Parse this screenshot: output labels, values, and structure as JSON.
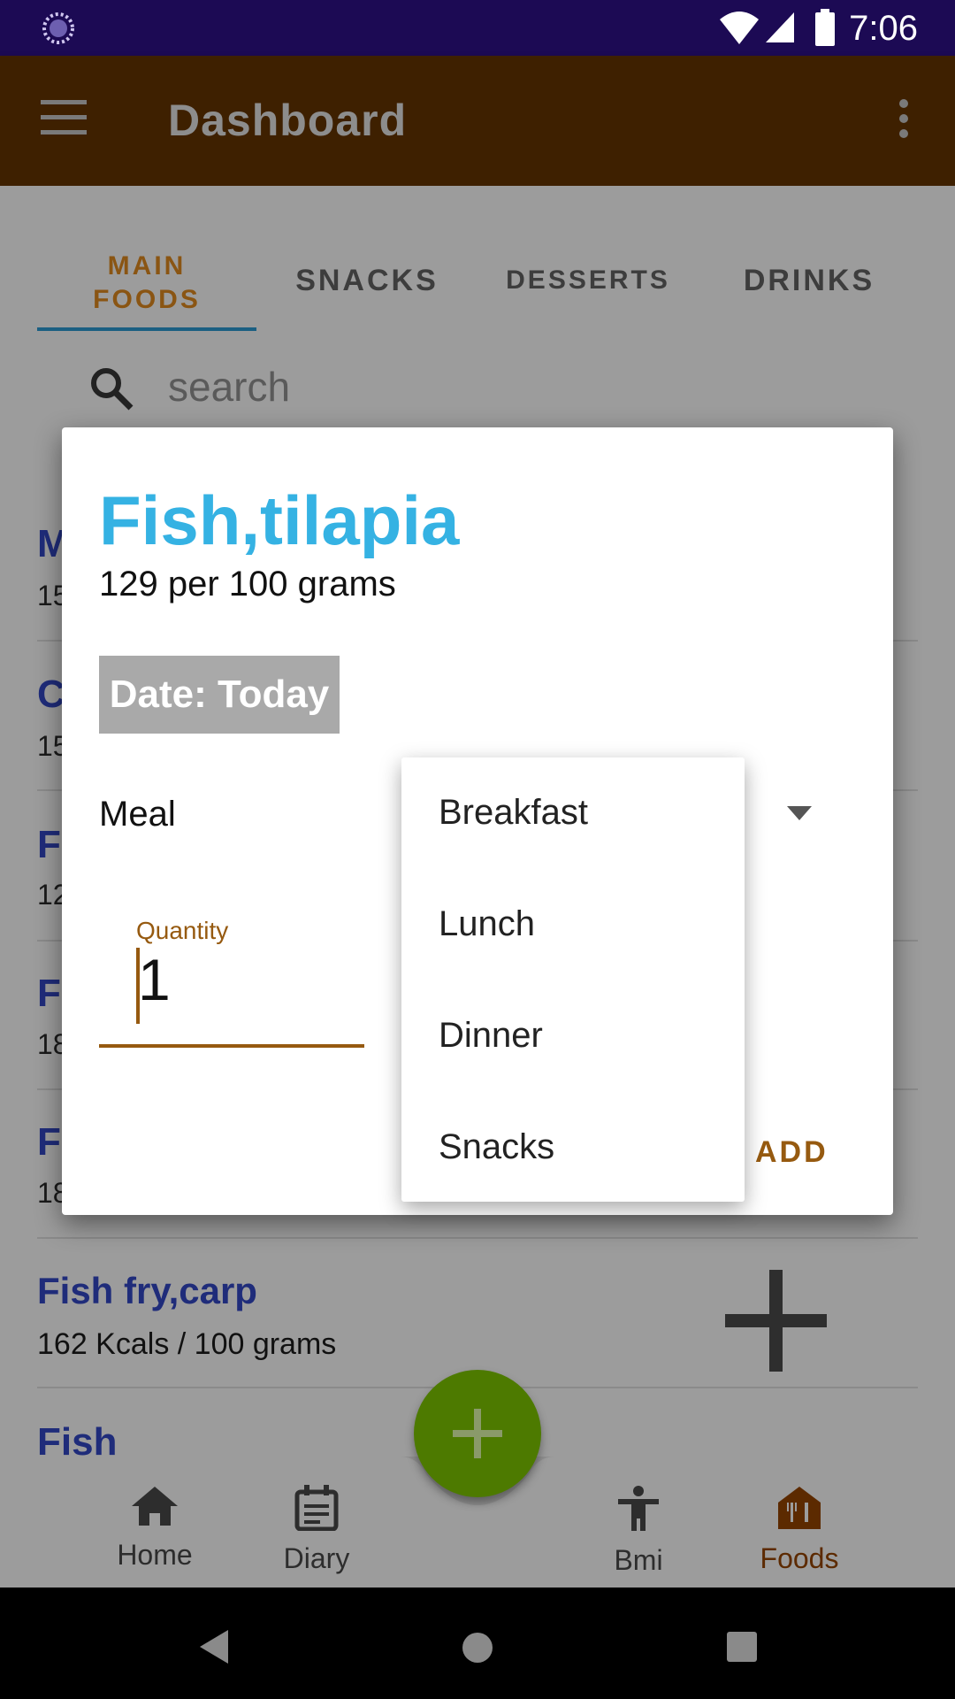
{
  "status_bar": {
    "time": "7:06"
  },
  "app_bar": {
    "title": "Dashboard"
  },
  "tabs": [
    {
      "label_line1": "MAIN",
      "label_line2": "FOODS"
    },
    {
      "label": "SNACKS"
    },
    {
      "label": "DESSERTS"
    },
    {
      "label": "DRINKS"
    }
  ],
  "search": {
    "placeholder": "search"
  },
  "background_list": {
    "partial_rows": [
      {
        "initial": "M",
        "sub": "15"
      },
      {
        "initial": "C",
        "sub": "15"
      },
      {
        "initial": "F",
        "sub": "12"
      },
      {
        "initial": "F",
        "sub": "18"
      },
      {
        "initial": "F",
        "sub": "18"
      }
    ],
    "visible_item": {
      "name": "Fish fry,carp",
      "kcal": "162 Kcals / 100 grams"
    },
    "last_item": {
      "name": "Fish"
    }
  },
  "bottom_nav": [
    {
      "label": "Home"
    },
    {
      "label": "Diary"
    },
    {
      "label": "Bmi"
    },
    {
      "label": "Foods"
    }
  ],
  "dialog": {
    "title": "Fish,tilapia",
    "subtitle": "129 per 100 grams",
    "date_button": "Date: Today",
    "meal_label": "Meal",
    "quantity_label": "Quantity",
    "quantity_value": "1",
    "add_button": "ADD"
  },
  "meal_dropdown": {
    "options": [
      "Breakfast",
      "Lunch",
      "Dinner",
      "Snacks"
    ]
  },
  "colors": {
    "accent": "#965a10",
    "title_blue": "#35b2e3",
    "status_bar": "#1c0a54",
    "fab": "#4d7a00"
  }
}
